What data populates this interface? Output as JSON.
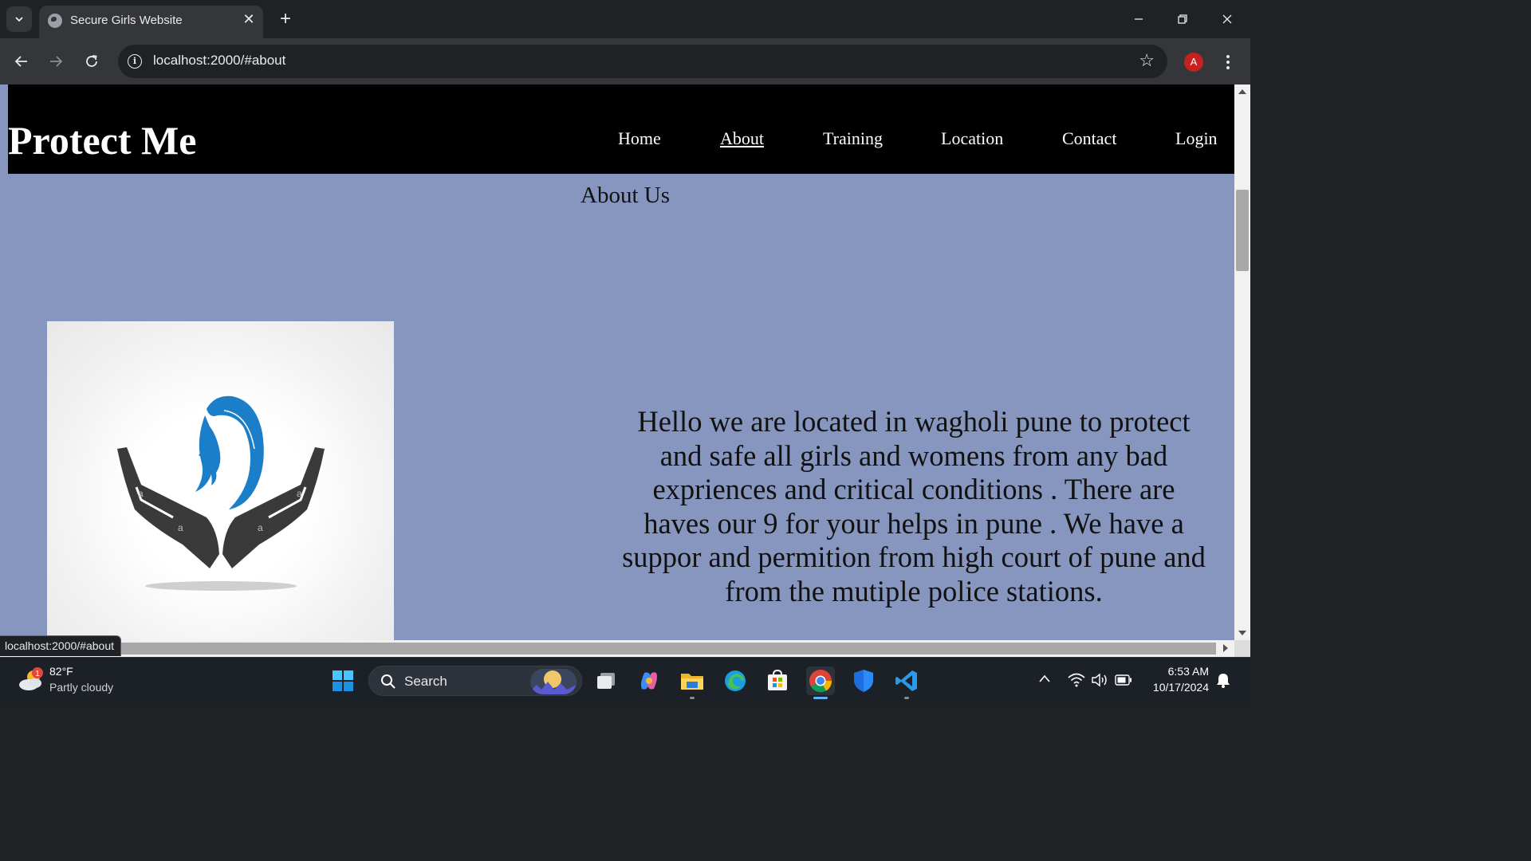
{
  "browser": {
    "tab_title": "Secure Girls Website",
    "url": "localhost:2000/#about",
    "profile_initial": "A",
    "status_url": "localhost:2000/#about"
  },
  "site": {
    "logo": "Protect Me",
    "nav": [
      "Home",
      "About",
      "Training",
      "Location",
      "Contact",
      "Login"
    ],
    "active_nav": "About",
    "heading": "About Us",
    "about_text": "Hello we are located in wagholi pune to protect and safe all girls and womens from any bad expriences and critical conditions . There are haves our 9 for your helps in pune . We have a suppor and permition from high court of pune and from the mutiple police stations.",
    "image_watermarks": [
      "a",
      "a",
      "a",
      "a"
    ]
  },
  "taskbar": {
    "weather_badge": "1",
    "weather_temp": "82°F",
    "weather_desc": "Partly cloudy",
    "search_label": "Search",
    "time": "6:53 AM",
    "date": "10/17/2024",
    "icons": [
      "windows-start-icon",
      "task-view-icon",
      "copilot-icon",
      "file-explorer-icon",
      "edge-icon",
      "microsoft-store-icon",
      "chrome-icon",
      "defender-icon",
      "vscode-icon"
    ]
  },
  "colors": {
    "page_background": "#8796bf",
    "header_background": "#000000",
    "hand_color": "#3a3a3a",
    "hair_color": "#1a7fc8",
    "profile_avatar": "#c5221f"
  }
}
